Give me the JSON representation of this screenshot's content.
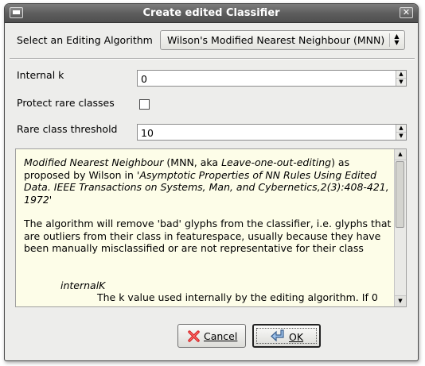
{
  "window": {
    "title": "Create edited Classifier"
  },
  "algorithm": {
    "label": "Select an Editing Algorithm",
    "selected": "Wilson's Modified Nearest Neighbour (MNN)"
  },
  "fields": {
    "internal_k": {
      "label": "Internal k",
      "value": "0"
    },
    "protect_rare": {
      "label": "Protect rare classes",
      "checked": false
    },
    "rare_threshold": {
      "label": "Rare class threshold",
      "value": "10"
    }
  },
  "description": {
    "p1_italic_a": "Modified Nearest Neighbour",
    "p1_plain_a": " (MNN, aka ",
    "p1_italic_b": "Leave-one-out-editing",
    "p1_plain_b": ") as proposed by Wilson in ",
    "p1_italic_c": "'Asymptotic Properties of NN Rules Using Edited Data. IEEE Transactions on Systems, Man, and Cybernetics,2(3):408-421, 1972'",
    "p2": "The algorithm will remove 'bad' glyphs from the classifier, i.e. glyphs that are outliers from their class in featurespace, usually because they have been manually misclassified or are not representative for their class",
    "param_name": "internalK",
    "param_desc": "The k value used internally by the editing algorithm. If 0"
  },
  "buttons": {
    "cancel": "Cancel",
    "ok": "OK"
  },
  "icons": {
    "cancel": "x-icon",
    "ok": "enter-arrow-icon"
  }
}
